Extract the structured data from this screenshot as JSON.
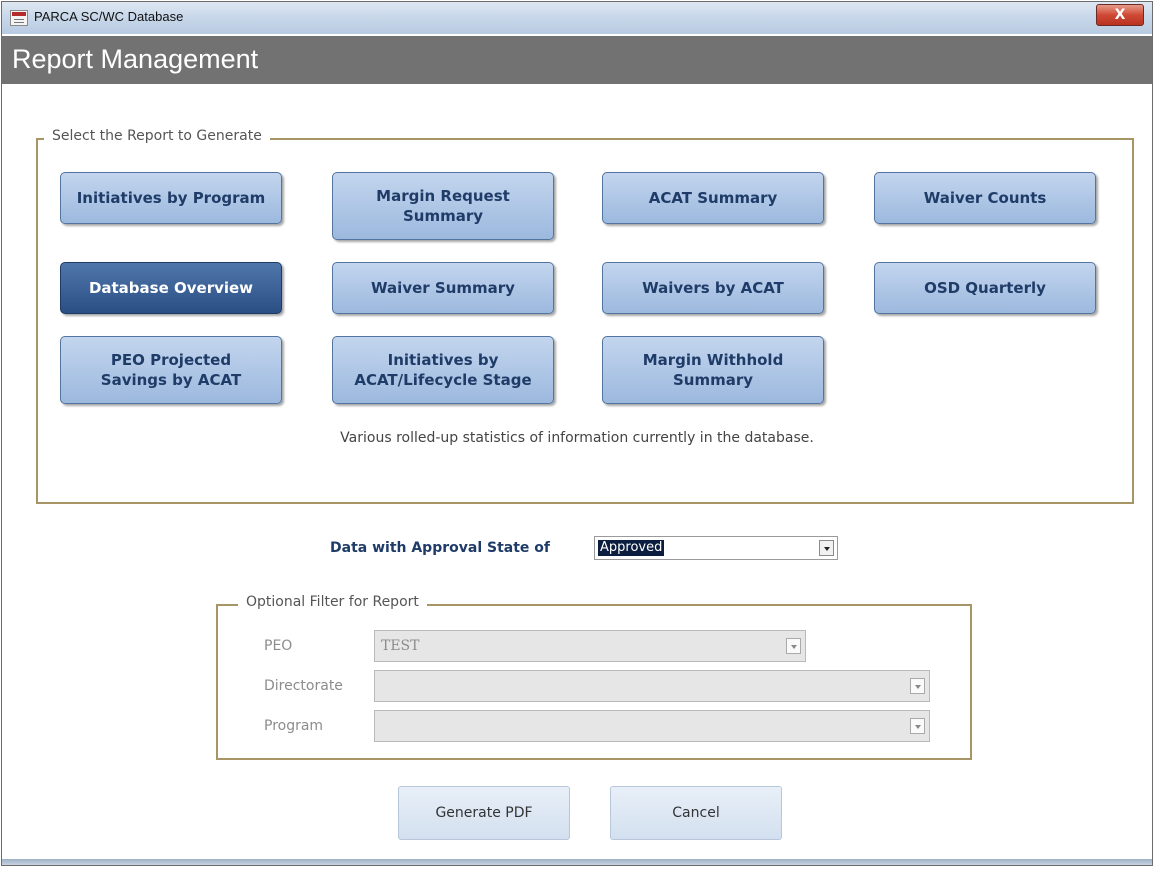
{
  "window": {
    "title": "PARCA SC/WC Database",
    "close_label": "X"
  },
  "header": {
    "title": "Report Management"
  },
  "report_group": {
    "legend": "Select the Report to Generate",
    "buttons": [
      {
        "label": "Initiatives by Program"
      },
      {
        "label": "Margin Request\nSummary"
      },
      {
        "label": "ACAT Summary"
      },
      {
        "label": "Waiver Counts"
      },
      {
        "label": "Database Overview",
        "selected": true
      },
      {
        "label": "Waiver Summary"
      },
      {
        "label": "Waivers by ACAT"
      },
      {
        "label": "OSD Quarterly"
      },
      {
        "label": "PEO Projected\nSavings by ACAT"
      },
      {
        "label": "Initiatives by\nACAT/Lifecycle Stage"
      },
      {
        "label": "Margin Withhold\nSummary"
      }
    ],
    "description": "Various rolled-up statistics of information currently in the database."
  },
  "approval": {
    "label": "Data with Approval State of",
    "value": "Approved"
  },
  "filter_group": {
    "legend": "Optional Filter for Report",
    "peo": {
      "label": "PEO",
      "value": "TEST"
    },
    "directorate": {
      "label": "Directorate",
      "value": ""
    },
    "program": {
      "label": "Program",
      "value": ""
    }
  },
  "actions": {
    "generate_label": "Generate PDF",
    "cancel_label": "Cancel"
  },
  "colors": {
    "header_bg": "#727272",
    "group_border": "#a89566",
    "button_blue": "#9cb9de",
    "button_selected": "#2a4f85",
    "button_text": "#1f3c68"
  }
}
